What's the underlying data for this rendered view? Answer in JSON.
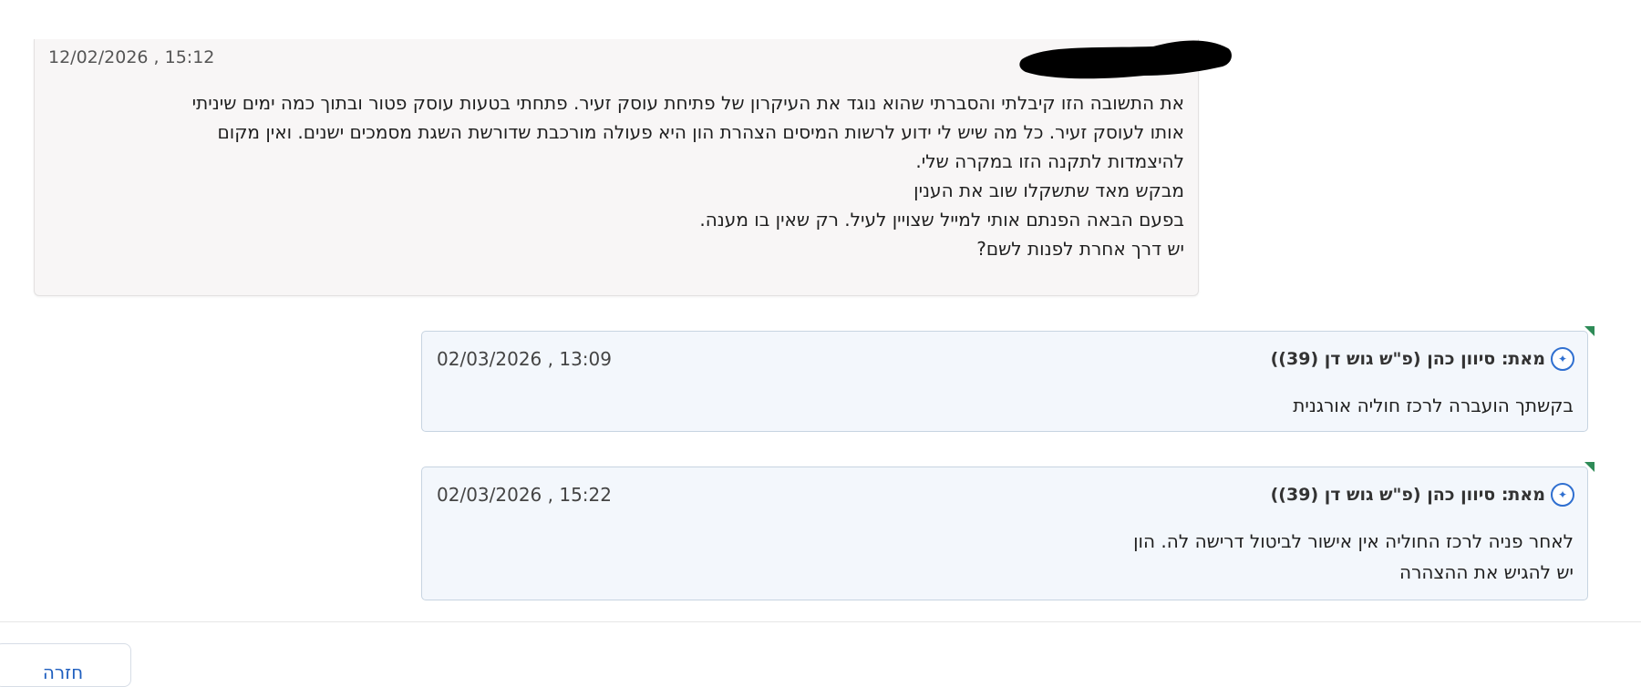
{
  "messages": [
    {
      "timestamp": "12/02/2026 , 15:12",
      "sender_redacted": true,
      "lines": [
        "את התשובה הזו קיבלתי והסברתי שהוא נוגד את העיקרון של פתיחת עוסק זעיר. פתחתי בטעות עוסק פטור ובתוך כמה ימים שיניתי",
        "אותו לעוסק זעיר. כל מה שיש לי ידוע לרשות המיסים הצהרת הון היא פעולה מורכבת שדורשת השגת מסמכים ישנים. ואין מקום",
        "להיצמדות לתקנה הזו במקרה שלי.",
        "מבקש מאד שתשקלו שוב את הענין",
        "בפעם הבאה הפנתם אותי למייל שצויין לעיל. רק שאין בו מענה.",
        "יש דרך אחרת לפנות לשם?"
      ]
    }
  ],
  "replies": [
    {
      "sender": "מאת: סיוון כהן (פ\"ש גוש דן (39))",
      "timestamp": "02/03/2026 , 13:09",
      "lines": [
        "בקשתך הועברה לרכז חוליה אורגנית"
      ],
      "avatar_icon": "office-seal-icon"
    },
    {
      "sender": "מאת: סיוון כהן (פ\"ש גוש דן (39))",
      "timestamp": "02/03/2026 , 15:22",
      "lines": [
        "לאחר פניה לרכז החוליה אין אישור לביטול דרישה לה. הון",
        "יש להגיש את ההצהרה"
      ],
      "avatar_icon": "office-seal-icon"
    }
  ],
  "footer": {
    "back_label": "חזרה"
  },
  "colors": {
    "user_bubble": "#f8f6f6",
    "reply_bubble": "#f3f7fc",
    "reply_border": "#c7d4e1",
    "corner_accent": "#2e8b57",
    "link_blue": "#1f5fbf"
  }
}
